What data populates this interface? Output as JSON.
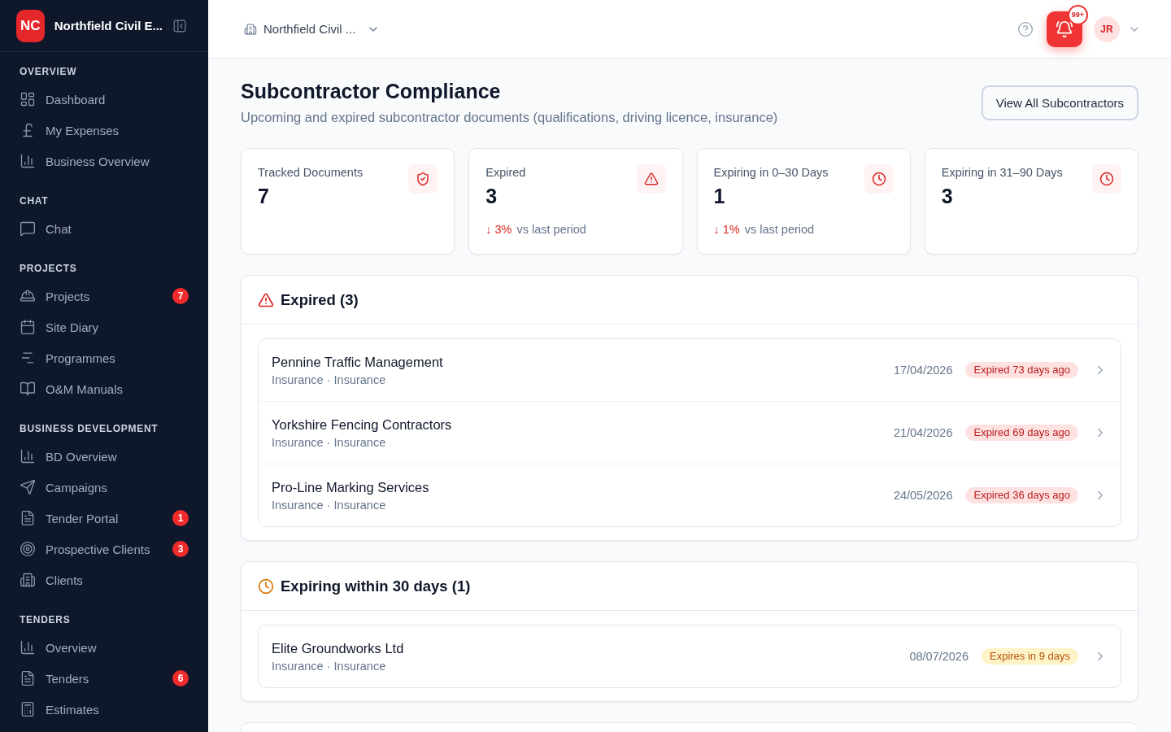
{
  "sidebar": {
    "brand": {
      "initials": "NC",
      "name": "Northfield Civil E..."
    },
    "sections": [
      {
        "title": "OVERVIEW",
        "items": [
          {
            "label": "Dashboard",
            "selected": false
          },
          {
            "label": "My Expenses",
            "selected": false
          },
          {
            "label": "Business Overview",
            "selected": false
          }
        ]
      },
      {
        "title": "CHAT",
        "items": [
          {
            "label": "Chat",
            "selected": false
          }
        ]
      },
      {
        "title": "PROJECTS",
        "items": [
          {
            "label": "Projects",
            "selected": false,
            "badge": "7"
          },
          {
            "label": "Site Diary",
            "selected": false
          },
          {
            "label": "Programmes",
            "selected": false
          },
          {
            "label": "O&M Manuals",
            "selected": false
          }
        ]
      },
      {
        "title": "BUSINESS DEVELOPMENT",
        "items": [
          {
            "label": "BD Overview",
            "selected": false
          },
          {
            "label": "Campaigns",
            "selected": false
          },
          {
            "label": "Tender Portal",
            "selected": false,
            "badge": "1"
          },
          {
            "label": "Prospective Clients",
            "selected": false,
            "badge": "3"
          },
          {
            "label": "Clients",
            "selected": false
          }
        ]
      },
      {
        "title": "TENDERS",
        "items": [
          {
            "label": "Overview",
            "selected": false
          },
          {
            "label": "Tenders",
            "selected": false,
            "badge": "6"
          },
          {
            "label": "Estimates",
            "selected": false
          }
        ]
      }
    ]
  },
  "header": {
    "organization": "Northfield Civil ...",
    "notifications": "99+",
    "avatar": "JR"
  },
  "page": {
    "title": "Subcontractor Compliance",
    "subtitle": "Upcoming and expired subcontractor documents (qualifications, driving licence, insurance)",
    "action": "View All Subcontractors"
  },
  "stats": [
    {
      "kind": "total",
      "label": "Tracked Documents",
      "value": "7"
    },
    {
      "kind": "expired",
      "label": "Expired",
      "value": "3",
      "change": "↓ 3%",
      "comparison": "vs last period"
    },
    {
      "kind": "expiring",
      "label": "Expiring in 0–30 Days",
      "value": "1",
      "change": "↓ 1%",
      "comparison": "vs last period"
    },
    {
      "kind": "expiring",
      "label": "Expiring in 31–90 Days",
      "value": "3"
    }
  ],
  "sections": [
    {
      "kind": "expired",
      "title": "Expired (3)",
      "rows": [
        {
          "name": "Pennine Traffic Management",
          "detail": "Insurance · Insurance",
          "date": "17/04/2026",
          "status": "Expired 73 days ago"
        },
        {
          "name": "Yorkshire Fencing Contractors",
          "detail": "Insurance · Insurance",
          "date": "21/04/2026",
          "status": "Expired 69 days ago"
        },
        {
          "name": "Pro-Line Marking Services",
          "detail": "Insurance · Insurance",
          "date": "24/05/2026",
          "status": "Expired 36 days ago"
        }
      ]
    },
    {
      "kind": "expiring",
      "title": "Expiring within 30 days (1)",
      "rows": [
        {
          "name": "Elite Groundworks Ltd",
          "detail": "Insurance · Insurance",
          "date": "08/07/2026",
          "status": "Expires in 9 days"
        }
      ]
    }
  ]
}
